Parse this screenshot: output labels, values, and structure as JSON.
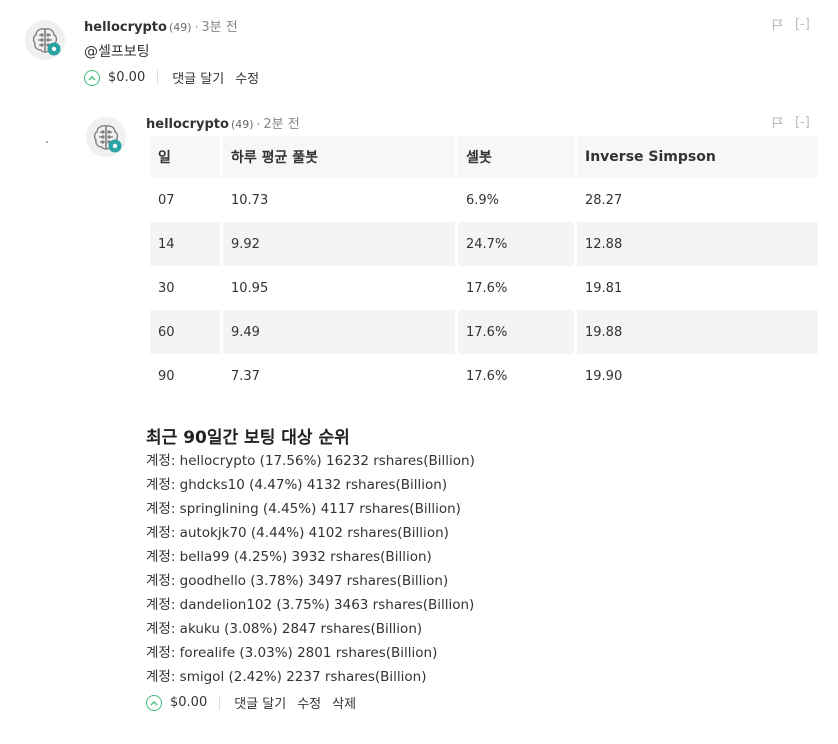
{
  "comment1": {
    "author": "hellocrypto",
    "reputation": "(49)",
    "dot": "·",
    "time": "3분 전",
    "text": "@셀프보팅",
    "payout": "$0.00",
    "actions": [
      "댓글 달기",
      "수정"
    ],
    "collapse": "[-]"
  },
  "comment2": {
    "author": "hellocrypto",
    "reputation": "(49)",
    "dot": "·",
    "time": "2분 전",
    "collapse": "[-]",
    "table": {
      "headers": [
        "일",
        "하루 평균 풀봇",
        "셀봇",
        "Inverse Simpson"
      ],
      "rows": [
        [
          "07",
          "10.73",
          "6.9%",
          "28.27"
        ],
        [
          "14",
          "9.92",
          "24.7%",
          "12.88"
        ],
        [
          "30",
          "10.95",
          "17.6%",
          "19.81"
        ],
        [
          "60",
          "9.49",
          "17.6%",
          "19.88"
        ],
        [
          "90",
          "7.37",
          "17.6%",
          "19.90"
        ]
      ]
    },
    "section_title": "최근 90일간 보팅 대상 순위",
    "ranking": [
      "계정: hellocrypto (17.56%) 16232 rshares(Billion)",
      "계정: ghdcks10 (4.47%) 4132 rshares(Billion)",
      "계정: springlining (4.45%) 4117 rshares(Billion)",
      "계정: autokjk70 (4.44%) 4102 rshares(Billion)",
      "계정: bella99 (4.25%) 3932 rshares(Billion)",
      "계정: goodhello (3.78%) 3497 rshares(Billion)",
      "계정: dandelion102 (3.75%) 3463 rshares(Billion)",
      "계정: akuku (3.08%) 2847 rshares(Billion)",
      "계정: forealife (3.03%) 2801 rshares(Billion)",
      "계정: smigol (2.42%) 2237 rshares(Billion)"
    ],
    "payout": "$0.00",
    "actions": [
      "댓글 달기",
      "수정",
      "삭제"
    ]
  },
  "colors": {
    "vote_green": "#3fbd7b",
    "avatar_badge": "#29a3a3",
    "muted": "#bbbbbb"
  },
  "icons": [
    "brain-avatar-icon",
    "gear-badge-icon",
    "flag-icon",
    "upvote-chevron-icon"
  ]
}
